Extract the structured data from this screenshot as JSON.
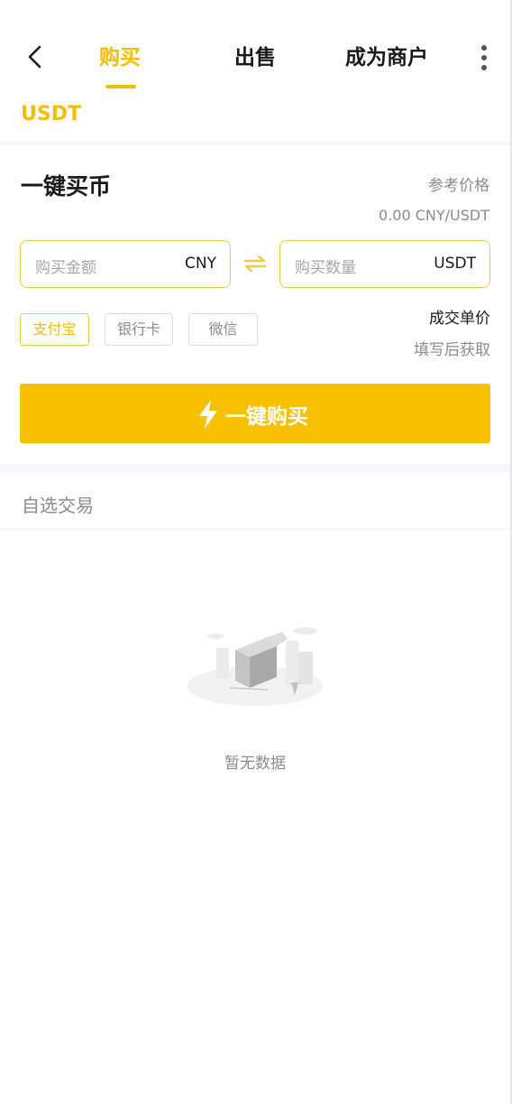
{
  "header": {
    "tabs": [
      {
        "label": "购买",
        "active": true
      },
      {
        "label": "出售",
        "active": false
      },
      {
        "label": "成为商户",
        "active": false
      }
    ],
    "back_icon": "chevron-left-icon",
    "more_icon": "more-vertical-icon"
  },
  "asset": "USDT",
  "quick_buy": {
    "title": "一键买币",
    "ref_price_label": "参考价格",
    "ref_price_value": "0.00 CNY/USDT",
    "amount_placeholder": "购买金额",
    "amount_unit": "CNY",
    "qty_placeholder": "购买数量",
    "qty_unit": "USDT",
    "payment_methods": [
      {
        "label": "支付宝",
        "selected": true
      },
      {
        "label": "银行卡",
        "selected": false
      },
      {
        "label": "微信",
        "selected": false
      }
    ],
    "unit_price_label": "成交单价",
    "unit_price_hint": "填写后获取",
    "buy_button_label": "一键购买",
    "buy_button_icon": "lightning-icon"
  },
  "favorites": {
    "title": "自选交易",
    "empty_text": "暂无数据"
  },
  "colors": {
    "accent": "#f5bd00",
    "button": "#f7c100",
    "muted": "#8c8c8c"
  }
}
